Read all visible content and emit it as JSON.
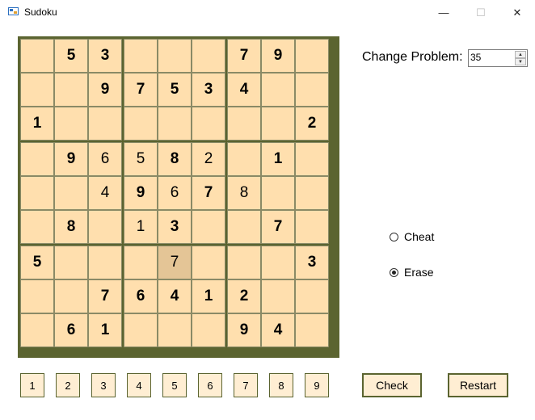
{
  "window": {
    "title": "Sudoku",
    "minimize": "—",
    "maximize": "☐",
    "close": "✕"
  },
  "board": [
    [
      {
        "v": "",
        "t": "given"
      },
      {
        "v": "5",
        "t": "given"
      },
      {
        "v": "3",
        "t": "given"
      },
      {
        "v": "",
        "t": "given"
      },
      {
        "v": "",
        "t": "given"
      },
      {
        "v": "",
        "t": "given"
      },
      {
        "v": "7",
        "t": "given"
      },
      {
        "v": "9",
        "t": "given"
      },
      {
        "v": "",
        "t": "given"
      }
    ],
    [
      {
        "v": "",
        "t": "given"
      },
      {
        "v": "",
        "t": "given"
      },
      {
        "v": "9",
        "t": "given"
      },
      {
        "v": "7",
        "t": "given"
      },
      {
        "v": "5",
        "t": "given"
      },
      {
        "v": "3",
        "t": "given"
      },
      {
        "v": "4",
        "t": "given"
      },
      {
        "v": "",
        "t": "given"
      },
      {
        "v": "",
        "t": "given"
      }
    ],
    [
      {
        "v": "1",
        "t": "given"
      },
      {
        "v": "",
        "t": "given"
      },
      {
        "v": "",
        "t": "given"
      },
      {
        "v": "",
        "t": "given"
      },
      {
        "v": "",
        "t": "given"
      },
      {
        "v": "",
        "t": "given"
      },
      {
        "v": "",
        "t": "given"
      },
      {
        "v": "",
        "t": "given"
      },
      {
        "v": "2",
        "t": "given"
      }
    ],
    [
      {
        "v": "",
        "t": "given"
      },
      {
        "v": "9",
        "t": "given"
      },
      {
        "v": "6",
        "t": "user"
      },
      {
        "v": "5",
        "t": "user"
      },
      {
        "v": "8",
        "t": "given"
      },
      {
        "v": "2",
        "t": "user"
      },
      {
        "v": "",
        "t": "given"
      },
      {
        "v": "1",
        "t": "given"
      },
      {
        "v": "",
        "t": "given"
      }
    ],
    [
      {
        "v": "",
        "t": "given"
      },
      {
        "v": "",
        "t": "given"
      },
      {
        "v": "4",
        "t": "user"
      },
      {
        "v": "9",
        "t": "given"
      },
      {
        "v": "6",
        "t": "user"
      },
      {
        "v": "7",
        "t": "given"
      },
      {
        "v": "8",
        "t": "user"
      },
      {
        "v": "",
        "t": "given"
      },
      {
        "v": "",
        "t": "given"
      }
    ],
    [
      {
        "v": "",
        "t": "given"
      },
      {
        "v": "8",
        "t": "given"
      },
      {
        "v": "",
        "t": "given"
      },
      {
        "v": "1",
        "t": "user"
      },
      {
        "v": "3",
        "t": "given"
      },
      {
        "v": "",
        "t": "given"
      },
      {
        "v": "",
        "t": "given"
      },
      {
        "v": "7",
        "t": "given"
      },
      {
        "v": "",
        "t": "given"
      }
    ],
    [
      {
        "v": "5",
        "t": "given"
      },
      {
        "v": "",
        "t": "given"
      },
      {
        "v": "",
        "t": "given"
      },
      {
        "v": "",
        "t": "given"
      },
      {
        "v": "7",
        "t": "user",
        "selected": true
      },
      {
        "v": "",
        "t": "given"
      },
      {
        "v": "",
        "t": "given"
      },
      {
        "v": "",
        "t": "given"
      },
      {
        "v": "3",
        "t": "given"
      }
    ],
    [
      {
        "v": "",
        "t": "given"
      },
      {
        "v": "",
        "t": "given"
      },
      {
        "v": "7",
        "t": "given"
      },
      {
        "v": "6",
        "t": "given"
      },
      {
        "v": "4",
        "t": "given"
      },
      {
        "v": "1",
        "t": "given"
      },
      {
        "v": "2",
        "t": "given"
      },
      {
        "v": "",
        "t": "given"
      },
      {
        "v": "",
        "t": "given"
      }
    ],
    [
      {
        "v": "",
        "t": "given"
      },
      {
        "v": "6",
        "t": "given"
      },
      {
        "v": "1",
        "t": "given"
      },
      {
        "v": "",
        "t": "given"
      },
      {
        "v": "",
        "t": "given"
      },
      {
        "v": "",
        "t": "given"
      },
      {
        "v": "9",
        "t": "given"
      },
      {
        "v": "4",
        "t": "given"
      },
      {
        "v": "",
        "t": "given"
      }
    ]
  ],
  "change_problem": {
    "label": "Change Problem:",
    "value": "35"
  },
  "options": [
    {
      "label": "Cheat",
      "checked": false
    },
    {
      "label": "Erase",
      "checked": true
    }
  ],
  "number_buttons": [
    "1",
    "2",
    "3",
    "4",
    "5",
    "6",
    "7",
    "8",
    "9"
  ],
  "actions": {
    "check": "Check",
    "restart": "Restart"
  },
  "colors": {
    "cell": "#ffdfae",
    "selected": "#e4c596",
    "grid": "#5b6430",
    "button_bg": "#ffeed3"
  }
}
